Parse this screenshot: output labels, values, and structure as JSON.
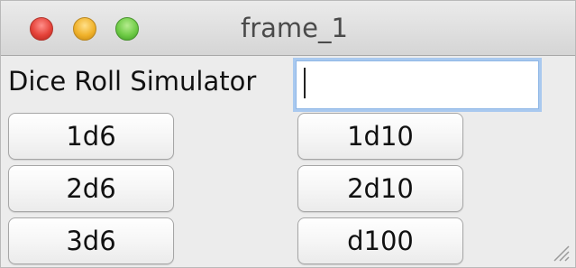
{
  "window": {
    "title": "frame_1"
  },
  "app": {
    "label": "Dice Roll Simulator",
    "input_value": ""
  },
  "buttons": {
    "b1d6": "1d6",
    "b2d6": "2d6",
    "b3d6": "3d6",
    "b1d10": "1d10",
    "b2d10": "2d10",
    "bd100": "d100"
  },
  "icons": {
    "close": "close-window-icon",
    "minimize": "minimize-window-icon",
    "zoom": "zoom-window-icon",
    "resize": "resize-grip-icon"
  },
  "colors": {
    "close": "#e5433a",
    "minimize": "#f0b22b",
    "zoom": "#6fcb46",
    "focus_ring": "#a9c9ef"
  }
}
